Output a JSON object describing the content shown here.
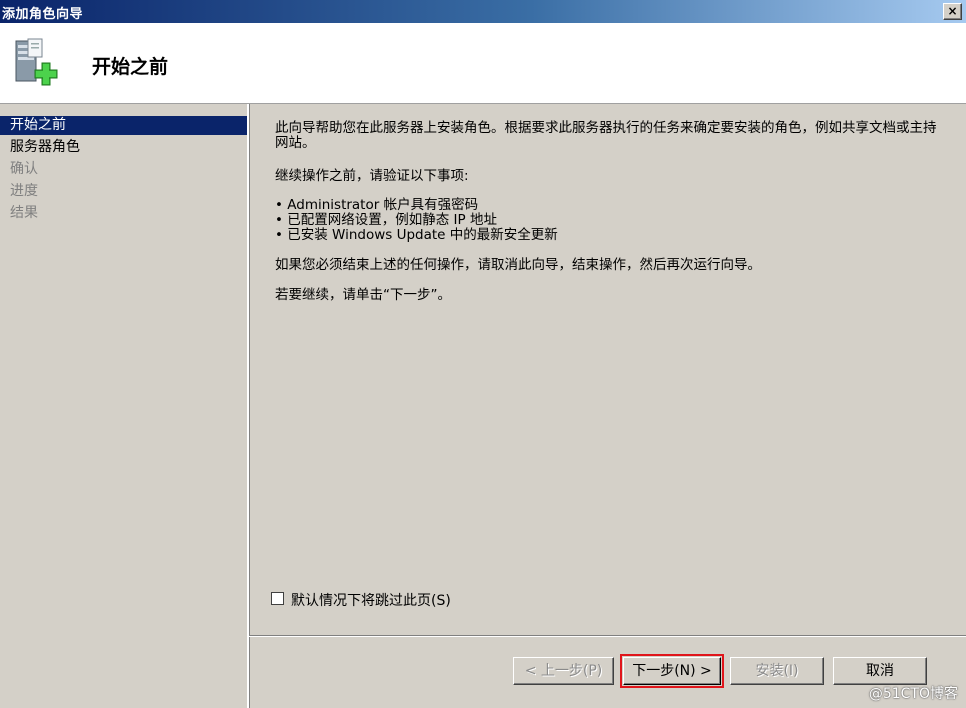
{
  "window": {
    "title": "添加角色向导",
    "close_glyph": "×"
  },
  "header": {
    "title": "开始之前",
    "icon": "server-add-icon"
  },
  "sidebar": {
    "items": [
      {
        "label": "开始之前",
        "state": "active"
      },
      {
        "label": "服务器角色",
        "state": "enabled"
      },
      {
        "label": "确认",
        "state": "disabled"
      },
      {
        "label": "进度",
        "state": "disabled"
      },
      {
        "label": "结果",
        "state": "disabled"
      }
    ]
  },
  "content": {
    "intro": "此向导帮助您在此服务器上安装角色。根据要求此服务器执行的任务来确定要安装的角色，例如共享文档或主持网站。",
    "verify_heading": "继续操作之前，请验证以下事项:",
    "bullets": [
      "• Administrator 帐户具有强密码",
      "• 已配置网络设置，例如静态 IP 地址",
      "• 已安装 Windows Update 中的最新安全更新"
    ],
    "cancel_note": "如果您必须结束上述的任何操作，请取消此向导，结束操作，然后再次运行向导。",
    "continue_note": "若要继续，请单击“下一步”。"
  },
  "skip_checkbox": {
    "label": "默认情况下将跳过此页(S)",
    "checked": false
  },
  "buttons": {
    "back": "< 上一步(P)",
    "next": "下一步(N) >",
    "install": "安装(I)",
    "cancel": "取消"
  },
  "watermark": "@51CTO博客"
}
